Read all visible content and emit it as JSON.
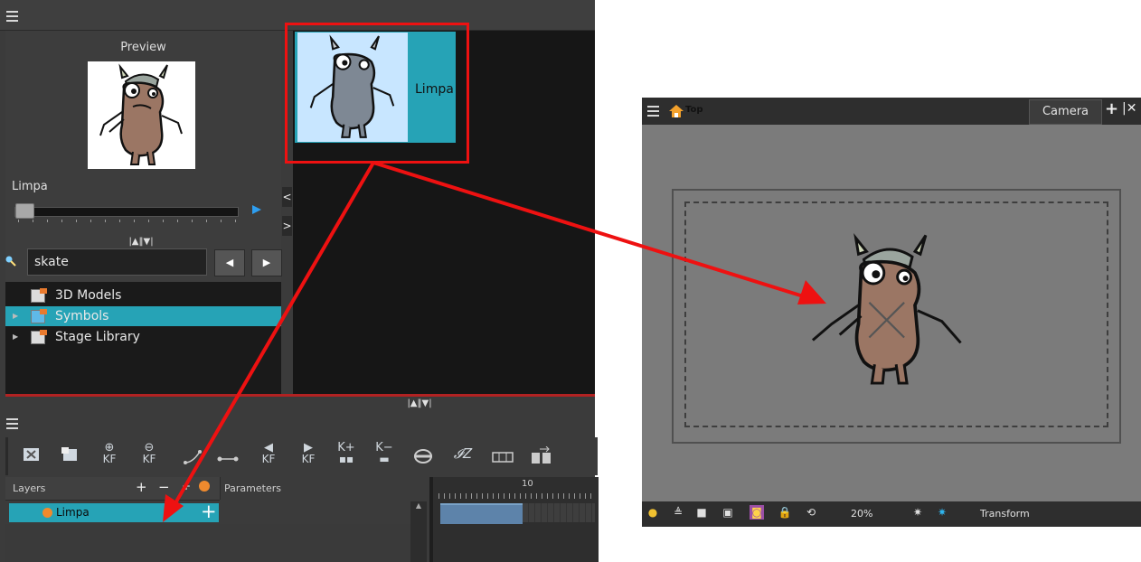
{
  "library": {
    "preview_title": "Preview",
    "preview_name": "Limpa",
    "search_value": "skate",
    "tree": [
      {
        "label": "3D Models",
        "expandable": false,
        "selected": false
      },
      {
        "label": "Symbols",
        "expandable": true,
        "selected": true
      },
      {
        "label": "Stage Library",
        "expandable": true,
        "selected": false
      }
    ],
    "thumbnail_label": "Limpa"
  },
  "timeline": {
    "layers_header": "Layers",
    "parameters_header": "Parameters",
    "frame_marker": "10",
    "layer_name": "Limpa",
    "toolbar_kf_labels": [
      "KF",
      "KF",
      "KF",
      "KF"
    ]
  },
  "camera_view": {
    "title": "Top",
    "camera_button": "Camera",
    "zoom": "20%",
    "mode": "Transform"
  },
  "colors": {
    "selection": "#26a3b6",
    "callout": "#ee1111",
    "panel_dark": "#161616",
    "panel_mid": "#3d3d3d",
    "viewport_bg": "#7b7b7b"
  }
}
